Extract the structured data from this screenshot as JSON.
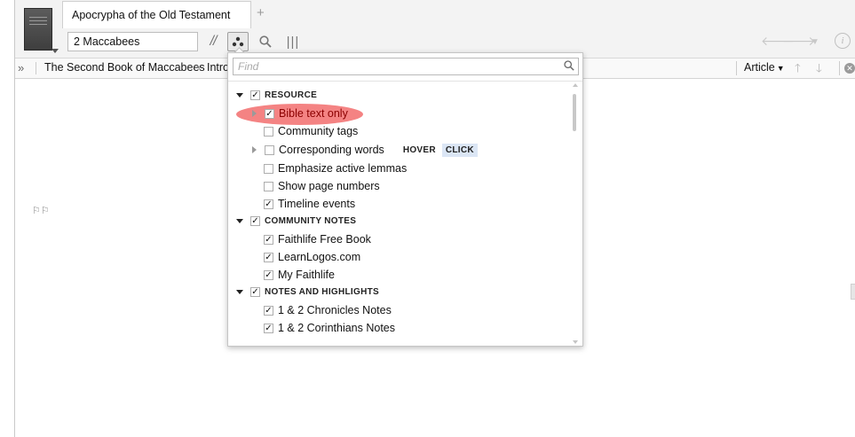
{
  "tab": {
    "title": "Apocrypha of the Old Testament",
    "add_label": "+"
  },
  "toolbar": {
    "reference_value": "2 Maccabees",
    "parallel_label": "//",
    "columns_label": "|||"
  },
  "breadcrumb": {
    "expand_label": "»",
    "title": "The Second Book of Maccabees",
    "separator": "›",
    "current": "Intro",
    "article_label": "Article"
  },
  "dropdown": {
    "find_placeholder": "Find",
    "sections": [
      {
        "label": "RESOURCE",
        "checked": true
      },
      {
        "label": "COMMUNITY NOTES",
        "checked": true
      },
      {
        "label": "NOTES AND HIGHLIGHTS",
        "checked": true
      }
    ],
    "resource_items": [
      {
        "label": "Bible text only",
        "checked": true,
        "expandable": true,
        "highlighted": true
      },
      {
        "label": "Community tags",
        "checked": false
      },
      {
        "label": "Corresponding words",
        "checked": false,
        "expandable": true
      },
      {
        "label": "Emphasize active lemmas",
        "checked": false
      },
      {
        "label": "Show page numbers",
        "checked": false
      },
      {
        "label": "Timeline events",
        "checked": true
      }
    ],
    "community_items": [
      {
        "label": "Faithlife Free Book",
        "checked": true
      },
      {
        "label": "LearnLogos.com",
        "checked": true
      },
      {
        "label": "My Faithlife",
        "checked": true
      }
    ],
    "notes_items": [
      {
        "label": "1 & 2 Chronicles Notes",
        "checked": true
      },
      {
        "label": "1 & 2 Corinthians Notes",
        "checked": true
      }
    ],
    "hover_label": "HOVER",
    "click_label": "CLICK"
  },
  "colors": {
    "highlight": "#f05a5a",
    "click_tag_bg": "#dbe6f5"
  }
}
